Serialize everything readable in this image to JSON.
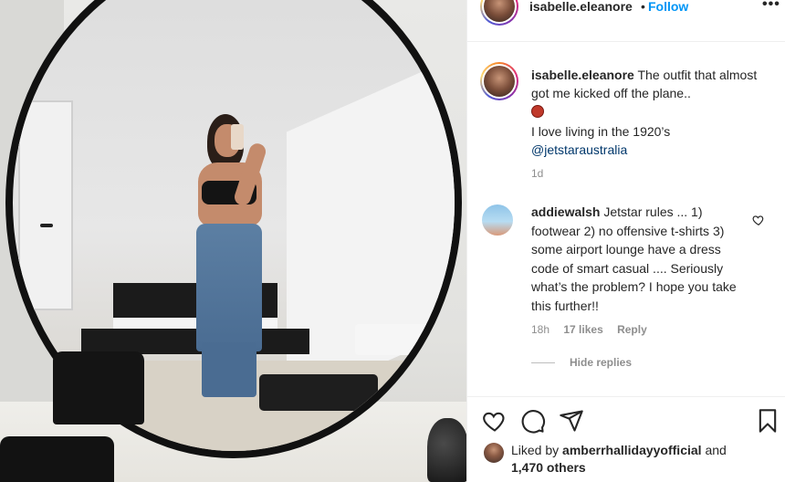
{
  "post": {
    "username": "isabelle.eleanore",
    "dot": "•",
    "follow_label": "Follow",
    "more_label": "•••"
  },
  "caption": {
    "username": "isabelle.eleanore",
    "line1": " The outfit that almost got me kicked off the plane..",
    "line2": "I love living in the 1920’s",
    "mention": "@jetstaraustralia",
    "time": "1d"
  },
  "comment": {
    "username": "addiewalsh",
    "text": " Jetstar rules ... 1) footwear 2) no offensive t-shirts 3) some airport lounge have a dress code of smart casual .... Seriously what’s the problem? I hope you take this further!!",
    "time": "18h",
    "likes": "17 likes",
    "reply_label": "Reply",
    "hide_replies_label": "Hide replies"
  },
  "likes": {
    "prefix": "Liked by ",
    "liker": "amberrhallidayyofficial",
    "and": " and",
    "others": "1,470 others"
  },
  "icons": [
    "heart-icon",
    "comment-icon",
    "share-icon",
    "bookmark-icon",
    "comment-like-heart-icon",
    "more-options-icon"
  ]
}
